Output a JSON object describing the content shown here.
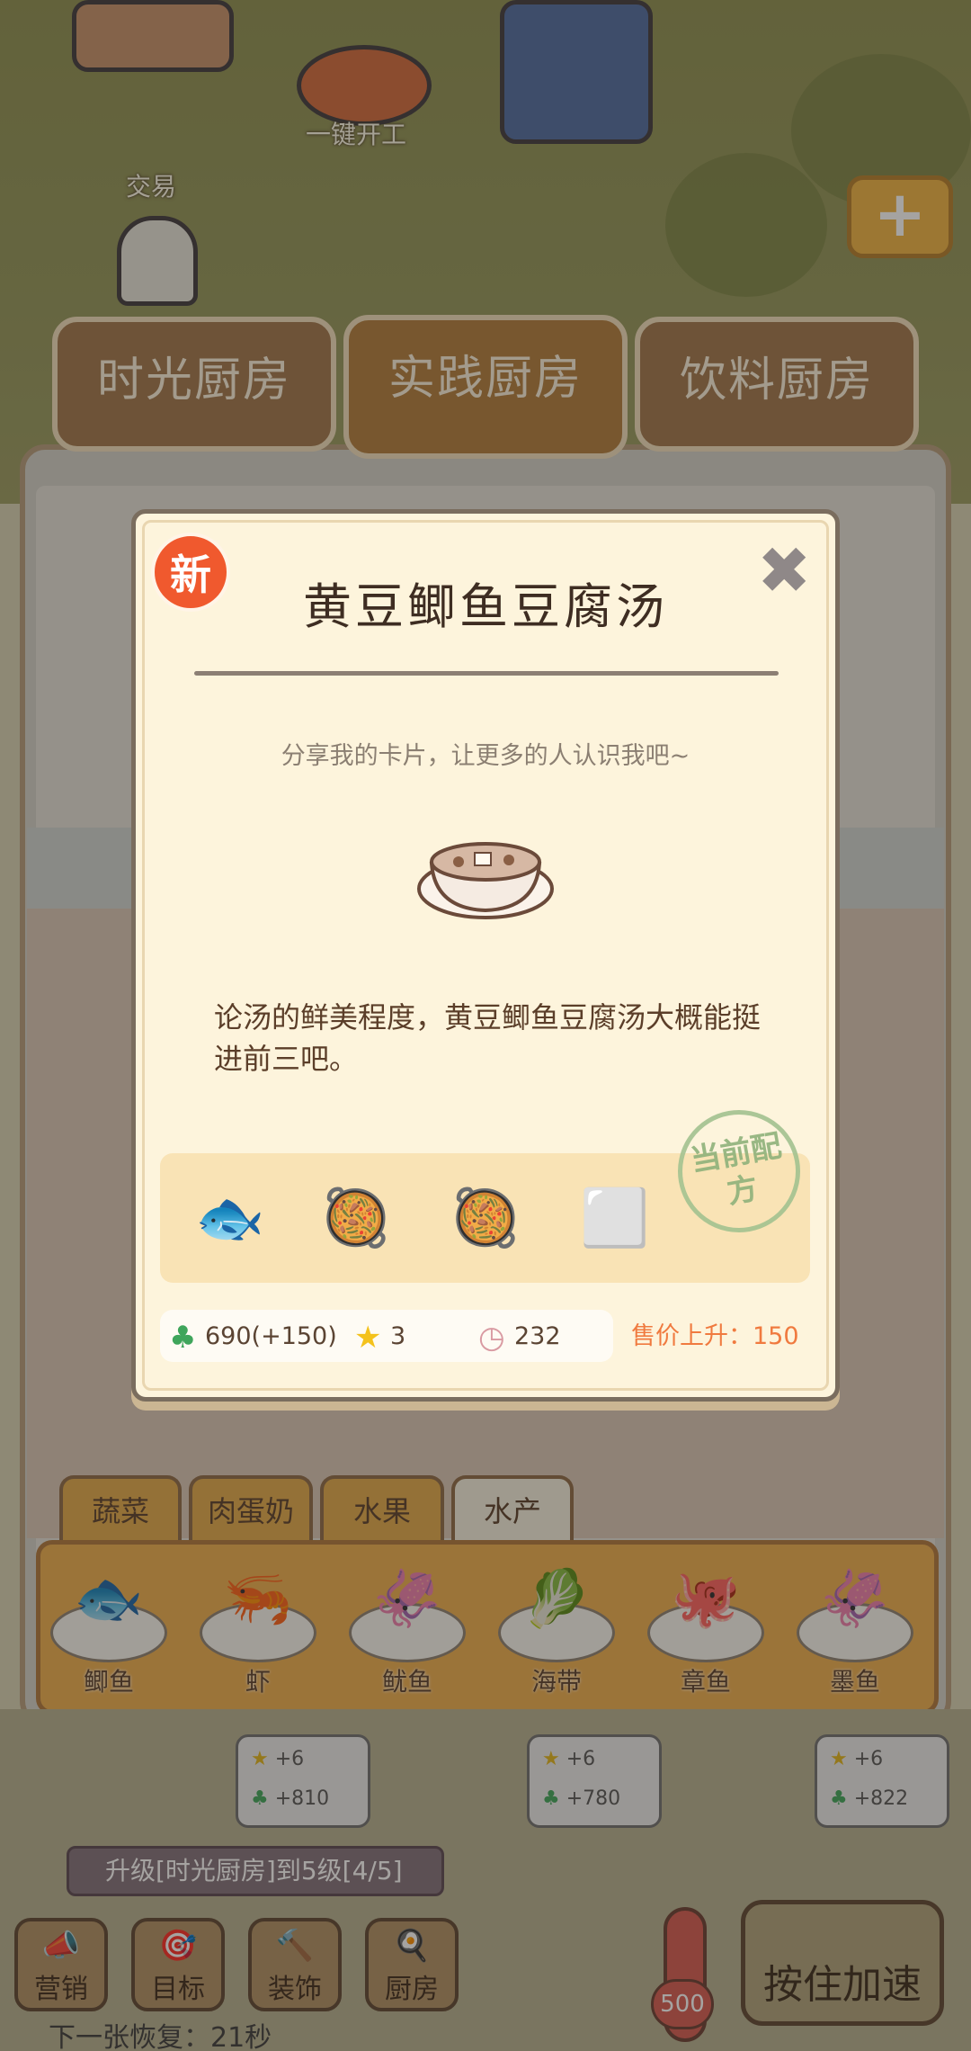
{
  "scene": {
    "one_key_label": "一键开工",
    "trade_label": "交易",
    "plus_icon": "+"
  },
  "kitchen_tabs": [
    {
      "label": "时光厨房"
    },
    {
      "label": "实践厨房"
    },
    {
      "label": "饮料厨房"
    }
  ],
  "categories": [
    {
      "label": "蔬菜"
    },
    {
      "label": "肉蛋奶"
    },
    {
      "label": "水果"
    },
    {
      "label": "水产"
    }
  ],
  "ingredients": [
    {
      "name": "鲫鱼",
      "icon": "🐟"
    },
    {
      "name": "虾",
      "icon": "🦐"
    },
    {
      "name": "鱿鱼",
      "icon": "🦑"
    },
    {
      "name": "海带",
      "icon": "🥬"
    },
    {
      "name": "章鱼",
      "icon": "🐙"
    },
    {
      "name": "墨鱼",
      "icon": "🦑"
    }
  ],
  "rewards": [
    {
      "star": "+6",
      "clover": "+810"
    },
    {
      "star": "+6",
      "clover": "+780"
    },
    {
      "star": "+6",
      "clover": "+822"
    }
  ],
  "task": {
    "text": "升级[时光厨房]到5级[4/5]"
  },
  "hud": [
    {
      "label": "营销",
      "icon": "📣"
    },
    {
      "label": "目标",
      "icon": "🎯"
    },
    {
      "label": "装饰",
      "icon": "🔨"
    },
    {
      "label": "厨房",
      "icon": "🍳"
    }
  ],
  "speed_button": "按住加速",
  "temperature": "500",
  "recover_text": "下一张恢复：21秒",
  "card": {
    "badge": "新",
    "close_icon": "✖",
    "title": "黄豆鲫鱼豆腐汤",
    "subtitle": "分享我的卡片，让更多的人认识我吧~",
    "description": "论汤的鲜美程度，黄豆鲫鱼豆腐汤大概能挺进前三吧。",
    "stamp": "当前配方",
    "recipe": [
      {
        "name": "fish-icon",
        "icon": "🐟"
      },
      {
        "name": "soybeans-icon",
        "icon": "🥘"
      },
      {
        "name": "soybeans-icon",
        "icon": "🥘"
      },
      {
        "name": "tofu-icon",
        "icon": "⬜"
      }
    ],
    "stats": {
      "clover": "690(+150)",
      "stars": "3",
      "time": "232"
    },
    "price_rise": "售价上升：150"
  },
  "colors": {
    "accent": "#f07a3f",
    "badge": "#f0592e",
    "card_bg": "#fdf4dc",
    "clover": "#3fa55b",
    "star": "#f4c21c"
  }
}
